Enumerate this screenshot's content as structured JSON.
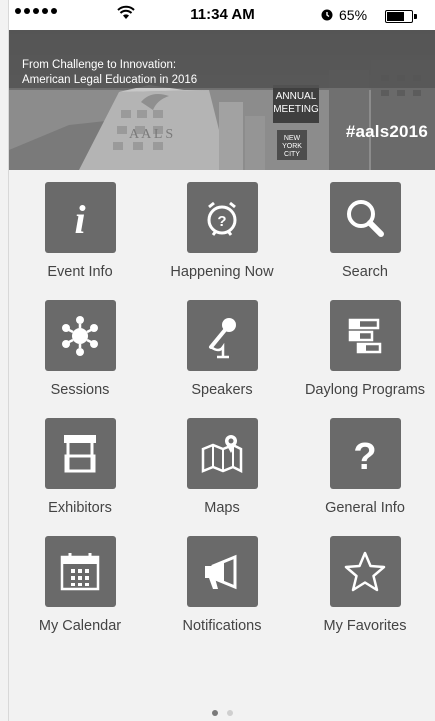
{
  "status_bar": {
    "time": "11:34 AM",
    "battery_percent": "65%",
    "battery_level": 0.65
  },
  "banner": {
    "tagline_line1": "From Challenge to Innovation:",
    "tagline_line2": "American Legal Education in 2016",
    "hashtag": "#aals2016",
    "sign_line1": "ANNUAL",
    "sign_line2": "MEETING",
    "city_line1": "NEW",
    "city_line2": "YORK",
    "city_line3": "CITY",
    "building_text": "A A L S"
  },
  "menu": [
    {
      "label": "Event Info",
      "icon": "info-icon"
    },
    {
      "label": "Happening Now",
      "icon": "alarm-clock-icon"
    },
    {
      "label": "Search",
      "icon": "search-icon"
    },
    {
      "label": "Sessions",
      "icon": "sessions-icon"
    },
    {
      "label": "Speakers",
      "icon": "microphone-icon"
    },
    {
      "label": "Daylong Programs",
      "icon": "programs-icon"
    },
    {
      "label": "Exhibitors",
      "icon": "booth-icon"
    },
    {
      "label": "Maps",
      "icon": "map-icon"
    },
    {
      "label": "General Info",
      "icon": "question-icon"
    },
    {
      "label": "My Calendar",
      "icon": "calendar-icon"
    },
    {
      "label": "Notifications",
      "icon": "megaphone-icon"
    },
    {
      "label": "My Favorites",
      "icon": "star-icon"
    }
  ],
  "page_indicator": {
    "pages": 2,
    "current": 1
  },
  "colors": {
    "tile_bg": "#6a6a6a",
    "label": "#444444",
    "background": "#f2f2f2"
  }
}
